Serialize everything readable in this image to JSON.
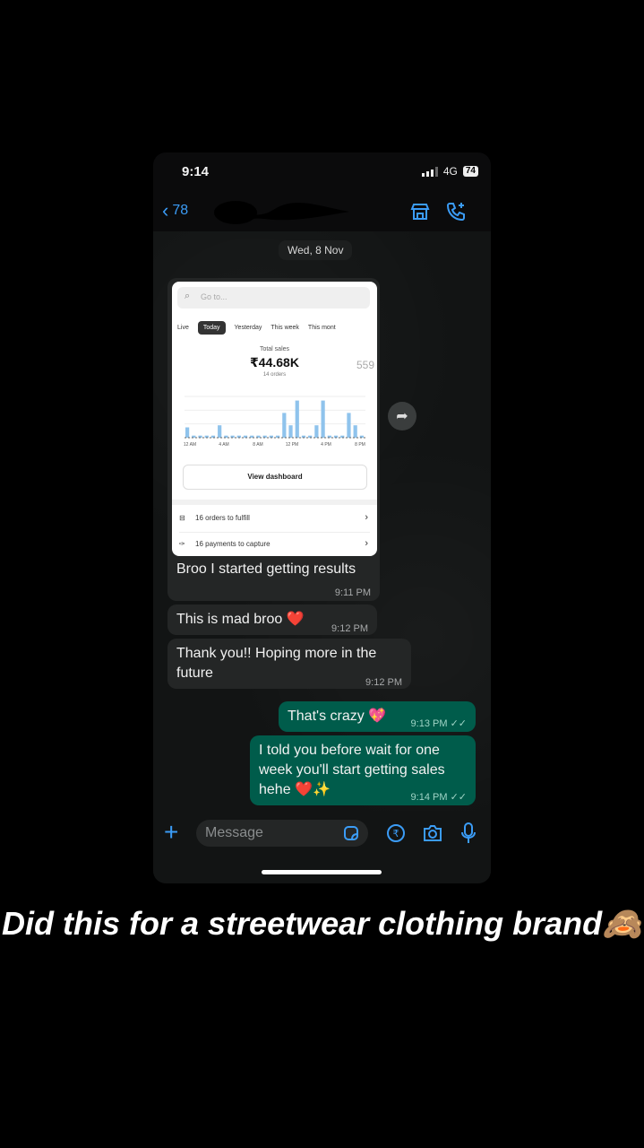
{
  "status_bar": {
    "time": "9:14",
    "network": "4G",
    "battery": "74"
  },
  "header": {
    "back_count": "78"
  },
  "date_label": "Wed, 8 Nov",
  "screenshot_card": {
    "search_placeholder": "Go to...",
    "tabs": [
      "Live",
      "Today",
      "Yesterday",
      "This week",
      "This mont"
    ],
    "active_tab": "Today",
    "metric_label": "Total sales",
    "metric_value": "₹44.68K",
    "metric_sub": "14 orders",
    "side_value": "559",
    "view_dashboard": "View dashboard",
    "orders_to_fulfill": "16 orders to fulfill",
    "payments_to_capture": "16 payments to capture",
    "x_ticks": [
      "12 AM",
      "4 AM",
      "8 AM",
      "12 PM",
      "4 PM",
      "8 PM"
    ],
    "chart_data": {
      "type": "bar",
      "values": [
        0.25,
        0.05,
        0.05,
        0.05,
        0.05,
        0.3,
        0.05,
        0.05,
        0.05,
        0.05,
        0.05,
        0.05,
        0.05,
        0.05,
        0.05,
        0.6,
        0.3,
        0.9,
        0.05,
        0.05,
        0.3,
        0.9,
        0.05,
        0.05,
        0.05,
        0.6,
        0.3,
        0.05
      ]
    }
  },
  "messages": [
    {
      "text": "Broo I started getting results",
      "time": "9:11 PM"
    },
    {
      "text": "This is mad broo ❤️",
      "time": "9:12 PM"
    },
    {
      "text": "Thank you!! Hoping more in the future",
      "time": "9:12 PM"
    },
    {
      "text": "That's crazy 💖",
      "time": "9:13 PM"
    },
    {
      "text": "I told you before wait for one week you'll start getting sales hehe ❤️✨",
      "time": "9:14 PM"
    }
  ],
  "composer": {
    "placeholder": "Message"
  },
  "caption": "Did this for a streetwear clothing brand🙈",
  "colors": {
    "accent": "#3b9cf6",
    "outgoing": "#005c4b",
    "incoming": "#242626",
    "chart_bar": "#8fc3ec"
  }
}
